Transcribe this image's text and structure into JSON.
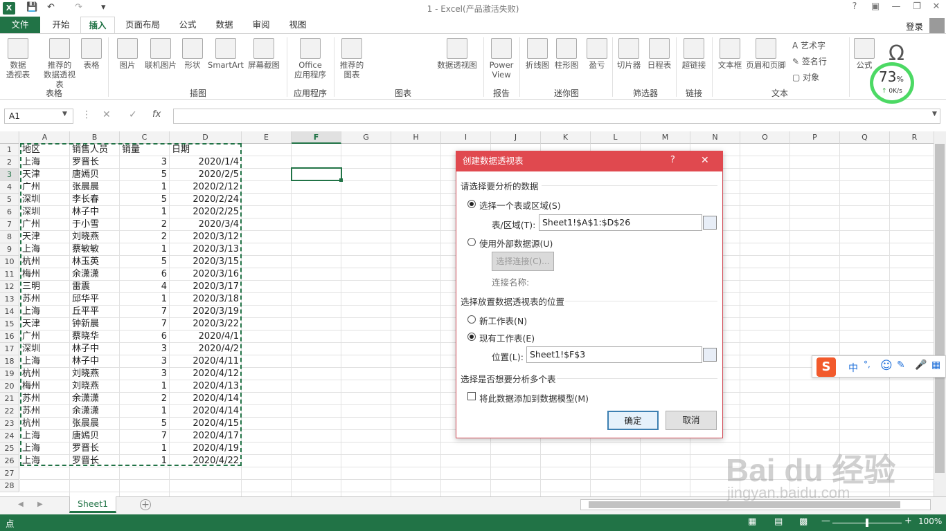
{
  "app": {
    "title": "1 - Excel(产品激活失败)",
    "logo": "X",
    "login": "登录"
  },
  "tabs": [
    "文件",
    "开始",
    "插入",
    "页面布局",
    "公式",
    "数据",
    "审阅",
    "视图"
  ],
  "active_tab_index": 2,
  "ribbon": {
    "buttons": [
      {
        "label": "数据\n透视表",
        "icon": "pivot-table-icon"
      },
      {
        "label": "推荐的\n数据透视表",
        "icon": "recommended-pivot-icon"
      },
      {
        "label": "表格",
        "icon": "table-icon"
      },
      {
        "label": "图片",
        "icon": "picture-icon"
      },
      {
        "label": "联机图片",
        "icon": "online-picture-icon"
      },
      {
        "label": "形状",
        "icon": "shapes-icon"
      },
      {
        "label": "SmartArt",
        "icon": "smartart-icon"
      },
      {
        "label": "屏幕截图",
        "icon": "screenshot-icon"
      },
      {
        "label": "Office\n应用程序",
        "icon": "office-apps-icon"
      },
      {
        "label": "推荐的\n图表",
        "icon": "recommended-chart-icon"
      },
      {
        "label": "数据透视图",
        "icon": "pivot-chart-icon"
      },
      {
        "label": "Power\nView",
        "icon": "power-view-icon"
      },
      {
        "label": "折线图",
        "icon": "sparkline-line-icon"
      },
      {
        "label": "柱形图",
        "icon": "sparkline-column-icon"
      },
      {
        "label": "盈亏",
        "icon": "sparkline-winloss-icon"
      },
      {
        "label": "切片器",
        "icon": "slicer-icon"
      },
      {
        "label": "日程表",
        "icon": "timeline-icon"
      },
      {
        "label": "超链接",
        "icon": "hyperlink-icon"
      },
      {
        "label": "文本框",
        "icon": "textbox-icon"
      },
      {
        "label": "页眉和页脚",
        "icon": "header-footer-icon"
      },
      {
        "label": "公式",
        "icon": "equation-icon"
      }
    ],
    "small_buttons": [
      "艺术字",
      "签名行",
      "对象"
    ],
    "groups": [
      "表格",
      "插图",
      "应用程序",
      "图表",
      "报告",
      "迷你图",
      "筛选器",
      "链接",
      "文本"
    ],
    "speed_widget": {
      "percent": "73",
      "percent_sign": "%",
      "rate": "0K/s"
    }
  },
  "formula_bar": {
    "name_box": "A1",
    "fx": "fx",
    "cancel": "✕",
    "enter": "✓"
  },
  "columns": [
    "A",
    "B",
    "C",
    "D",
    "E",
    "F",
    "G",
    "H",
    "I",
    "J",
    "K",
    "L",
    "M",
    "N",
    "O",
    "P",
    "Q",
    "R"
  ],
  "selected_column": "F",
  "rows": [
    [
      "地区",
      "销售人员",
      "销量",
      "日期"
    ],
    [
      "上海",
      "罗晋长",
      "3",
      "2020/1/4"
    ],
    [
      "天津",
      "唐嫣贝",
      "5",
      "2020/2/5"
    ],
    [
      "广州",
      "张晨晨",
      "1",
      "2020/2/12"
    ],
    [
      "深圳",
      "李长春",
      "5",
      "2020/2/24"
    ],
    [
      "深圳",
      "林子中",
      "1",
      "2020/2/25"
    ],
    [
      "广州",
      "于小雪",
      "2",
      "2020/3/4"
    ],
    [
      "天津",
      "刘晓燕",
      "2",
      "2020/3/12"
    ],
    [
      "上海",
      "蔡敏敏",
      "1",
      "2020/3/13"
    ],
    [
      "杭州",
      "林玉英",
      "5",
      "2020/3/15"
    ],
    [
      "梅州",
      "余潇潇",
      "6",
      "2020/3/16"
    ],
    [
      "三明",
      "雷震",
      "4",
      "2020/3/17"
    ],
    [
      "苏州",
      "邱华平",
      "1",
      "2020/3/18"
    ],
    [
      "上海",
      "丘平平",
      "7",
      "2020/3/19"
    ],
    [
      "天津",
      "钟新晨",
      "7",
      "2020/3/22"
    ],
    [
      "广州",
      "蔡晓华",
      "6",
      "2020/4/1"
    ],
    [
      "深圳",
      "林子中",
      "3",
      "2020/4/2"
    ],
    [
      "上海",
      "林子中",
      "3",
      "2020/4/11"
    ],
    [
      "杭州",
      "刘晓燕",
      "3",
      "2020/4/12"
    ],
    [
      "梅州",
      "刘晓燕",
      "1",
      "2020/4/13"
    ],
    [
      "苏州",
      "余潇潇",
      "2",
      "2020/4/14"
    ],
    [
      "苏州",
      "余潇潇",
      "1",
      "2020/4/14"
    ],
    [
      "杭州",
      "张晨晨",
      "5",
      "2020/4/15"
    ],
    [
      "上海",
      "唐嫣贝",
      "7",
      "2020/4/17"
    ],
    [
      "上海",
      "罗晋长",
      "1",
      "2020/4/19"
    ],
    [
      "上海",
      "罗晋长",
      "1",
      "2020/4/22"
    ],
    [
      "",
      "",
      "",
      ""
    ],
    [
      "",
      "",
      "",
      ""
    ]
  ],
  "selected_row": "3",
  "dialog": {
    "title": "创建数据透视表",
    "help": "?",
    "close": "✕",
    "section1": "请选择要分析的数据",
    "opt_range": "选择一个表或区域(S)",
    "range_label": "表/区域(T):",
    "range_value": "Sheet1!$A$1:$D$26",
    "opt_external": "使用外部数据源(U)",
    "choose_conn": "选择连接(C)...",
    "conn_name": "连接名称:",
    "section2": "选择放置数据透视表的位置",
    "opt_new": "新工作表(N)",
    "opt_existing": "现有工作表(E)",
    "loc_label": "位置(L):",
    "loc_value": "Sheet1!$F$3",
    "section3": "选择是否想要分析多个表",
    "add_model": "将此数据添加到数据模型(M)",
    "ok": "确定",
    "cancel": "取消"
  },
  "ime": {
    "lang": "中",
    "punct": "°,"
  },
  "sheet_tab": "Sheet1",
  "status": {
    "mode": "点",
    "zoom": "100%"
  },
  "watermark": {
    "brand": "Bai du 经验",
    "url": "jingyan.baidu.com"
  }
}
